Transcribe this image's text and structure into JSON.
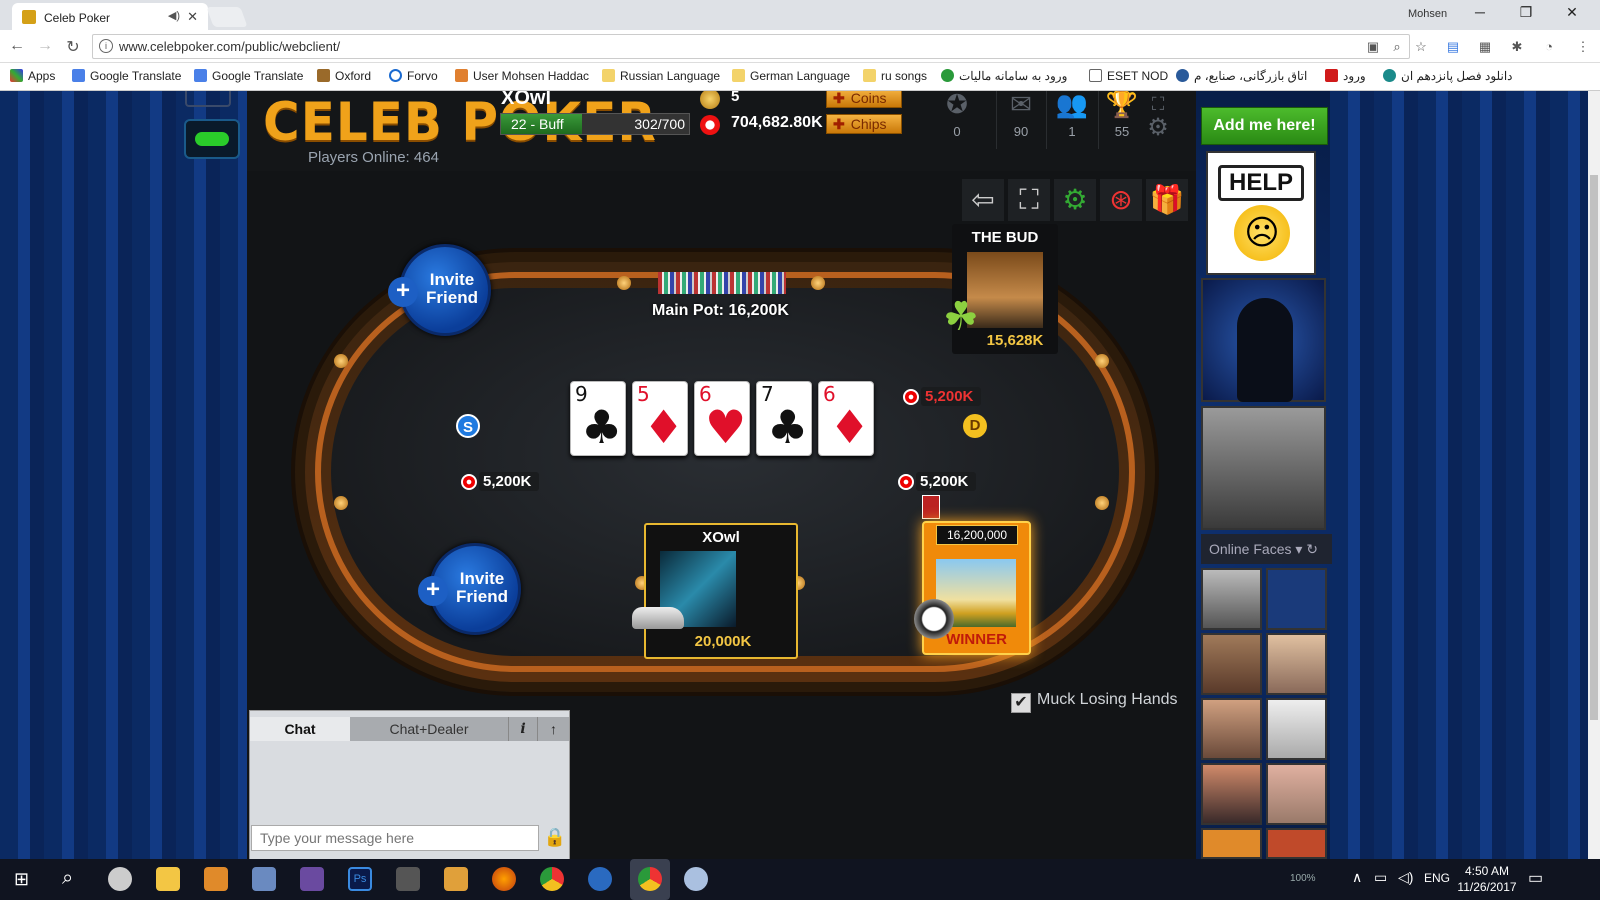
{
  "browser": {
    "tab_title": "Celeb Poker",
    "url": "www.celebpoker.com/public/webclient/",
    "user": "Mohsen",
    "bookmarks": [
      "Apps",
      "Google Translate",
      "Google Translate",
      "Oxford",
      "Forvo",
      "User Mohsen Haddac",
      "Russian Language",
      "German Language",
      "ru songs",
      "ورود به سامانه مالیات",
      "ESET NOD",
      "اتاق بازرگانی، صنایع، م",
      "ورود",
      "دانلود فصل پانزدهم ان"
    ]
  },
  "hud": {
    "logo": "CELEB POKER",
    "players_online": "Players Online: 464",
    "player_name": "XOwl",
    "level_label": "22 - Buff",
    "xp": "302/700",
    "xp_fraction": 0.43,
    "coins": "5",
    "chips": "704,682.80K",
    "coins_btn": "Coins",
    "chips_btn": "Chips",
    "stats": [
      "0",
      "90",
      "1",
      "55"
    ]
  },
  "table": {
    "main_pot": "Main Pot:  16,200K",
    "board": [
      {
        "rank": "9",
        "suit": "♣",
        "color": "blk"
      },
      {
        "rank": "5",
        "suit": "♦",
        "color": "red"
      },
      {
        "rank": "6",
        "suit": "♥",
        "color": "red"
      },
      {
        "rank": "7",
        "suit": "♣",
        "color": "blk"
      },
      {
        "rank": "6",
        "suit": "♦",
        "color": "red"
      }
    ],
    "bets": {
      "left": "5,200K",
      "right_top": "5,200K",
      "right_bottom": "5,200K"
    },
    "small_blind": "S",
    "dealer": "D",
    "invite_label": "Invite Friend",
    "seats": {
      "bud": {
        "name": "THE BUD",
        "stack": "15,628K"
      },
      "me": {
        "name": "XOwl",
        "stack": "20,000K"
      },
      "winner": {
        "amount": "16,200,000",
        "label": "WINNER"
      }
    }
  },
  "muck": "Muck Losing Hands",
  "chat": {
    "tab1": "Chat",
    "tab2": "Chat+Dealer",
    "placeholder": "Type your message here"
  },
  "sidebar": {
    "add_me": "Add me here!",
    "help": "HELP",
    "online_faces": "Online Faces"
  },
  "taskbar": {
    "lang": "ENG",
    "time": "4:50 AM",
    "date": "11/26/2017",
    "zoom": "100%"
  }
}
